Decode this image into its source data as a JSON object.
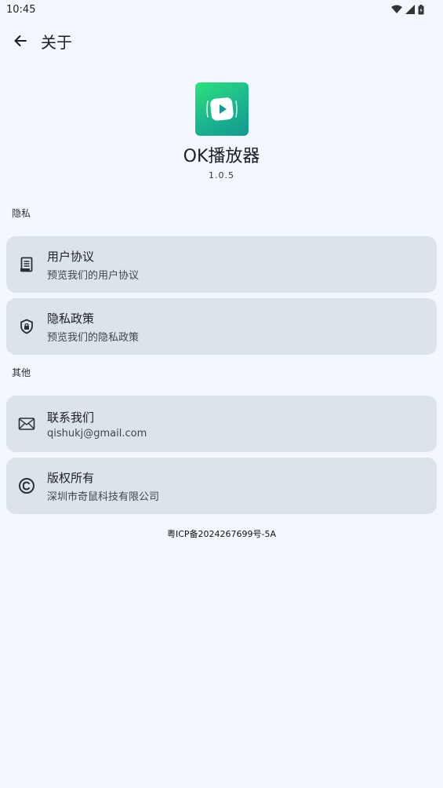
{
  "status": {
    "time": "10:45"
  },
  "appbar": {
    "title": "关于"
  },
  "app": {
    "name": "OK播放器",
    "version": "1.0.5"
  },
  "sections": {
    "privacy": {
      "label": "隐私",
      "items": [
        {
          "title": "用户协议",
          "subtitle": "预览我们的用户协议",
          "icon": "document-icon"
        },
        {
          "title": "隐私政策",
          "subtitle": "预览我们的隐私政策",
          "icon": "shield-lock-icon"
        }
      ]
    },
    "other": {
      "label": "其他",
      "items": [
        {
          "title": "联系我们",
          "subtitle": "qishukj@gmail.com",
          "icon": "mail-icon"
        },
        {
          "title": "版权所有",
          "subtitle": "深圳市奇鼠科技有限公司",
          "icon": "copyright-icon"
        }
      ]
    }
  },
  "footer": {
    "icp": "粤ICP备2024267699号-5A"
  },
  "colors": {
    "background": "#f3f8fe",
    "card": "#dde3ea",
    "logo_green": "#2ee37a",
    "logo_teal": "#13988f"
  }
}
